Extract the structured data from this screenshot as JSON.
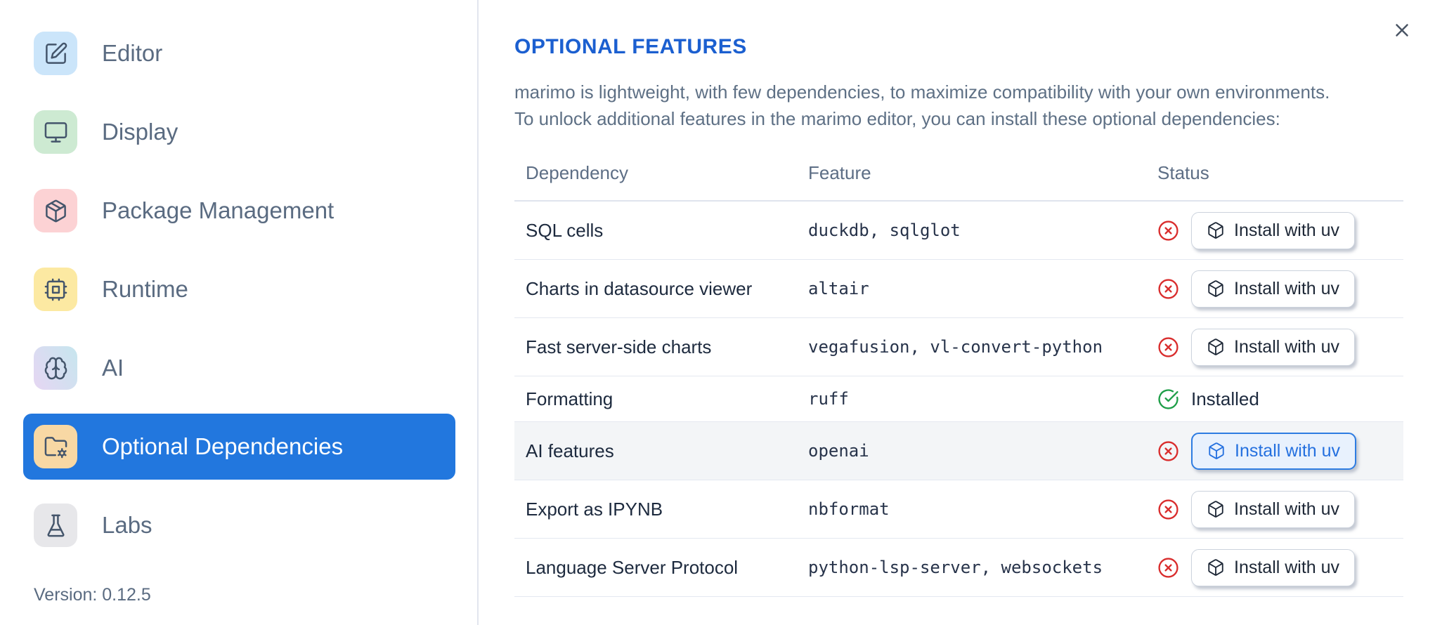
{
  "colors": {
    "accent": "#2277de",
    "title_blue": "#1b5fd0",
    "error_red": "#d92d2d",
    "success_green": "#1e9e48",
    "btn_active_bg": "#e8f1fd",
    "btn_active_border": "#2d7ce2",
    "btn_active_text": "#2470df"
  },
  "sidebar": {
    "items": [
      {
        "label": "Editor",
        "icon": "square-pen",
        "tile_bg": "#cbe5fa"
      },
      {
        "label": "Display",
        "icon": "monitor",
        "tile_bg": "#cdead2"
      },
      {
        "label": "Package Management",
        "icon": "package",
        "tile_bg": "#fcd2d4"
      },
      {
        "label": "Runtime",
        "icon": "cpu",
        "tile_bg": "#fce9a2"
      },
      {
        "label": "AI",
        "icon": "brain",
        "tile_bg": "linear-gradient(60deg,#e6d6f3,#c6e6ee)"
      },
      {
        "label": "Optional Dependencies",
        "icon": "folder-cog",
        "tile_bg": "#f8d8a4",
        "active": true
      },
      {
        "label": "Labs",
        "icon": "flask",
        "tile_bg": "#e7e7ea"
      }
    ],
    "version_label": "Version: 0.12.5"
  },
  "panel": {
    "title": "OPTIONAL FEATURES",
    "intro_line1": "marimo is lightweight, with few dependencies, to maximize compatibility with your own environments.",
    "intro_line2": "To unlock additional features in the marimo editor, you can install these optional dependencies:",
    "table": {
      "headers": [
        "Dependency",
        "Feature",
        "Status"
      ],
      "rows": [
        {
          "dependency": "SQL cells",
          "feature": "duckdb, sqlglot",
          "status": "missing",
          "action": "Install with uv"
        },
        {
          "dependency": "Charts in datasource viewer",
          "feature": "altair",
          "status": "missing",
          "action": "Install with uv"
        },
        {
          "dependency": "Fast server-side charts",
          "feature": "vegafusion, vl-convert-python",
          "status": "missing",
          "action": "Install with uv"
        },
        {
          "dependency": "Formatting",
          "feature": "ruff",
          "status": "installed",
          "status_label": "Installed"
        },
        {
          "dependency": "AI features",
          "feature": "openai",
          "status": "missing",
          "action": "Install with uv",
          "highlighted": true
        },
        {
          "dependency": "Export as IPYNB",
          "feature": "nbformat",
          "status": "missing",
          "action": "Install with uv"
        },
        {
          "dependency": "Language Server Protocol",
          "feature": "python-lsp-server, websockets",
          "status": "missing",
          "action": "Install with uv"
        }
      ]
    }
  }
}
